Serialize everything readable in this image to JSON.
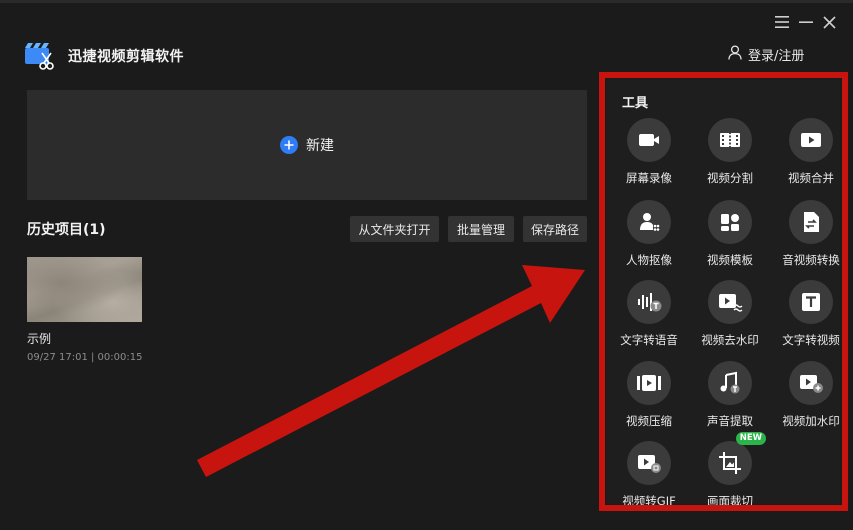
{
  "window": {
    "controls": [
      {
        "name": "menu",
        "icon": "hamburger-icon"
      },
      {
        "name": "minimize",
        "icon": "minimize-icon"
      },
      {
        "name": "close",
        "icon": "close-icon"
      }
    ]
  },
  "header": {
    "app_title": "迅捷视频剪辑软件",
    "logo_icon": "clapperboard-scissors-icon",
    "login_label": "登录/注册",
    "login_icon": "user-icon"
  },
  "new_project": {
    "label": "新建",
    "icon": "plus-circle-icon",
    "accent": "#2f7cf6"
  },
  "history": {
    "title": "历史项目(1)",
    "buttons": [
      "从文件夹打开",
      "批量管理",
      "保存路径"
    ],
    "items": [
      {
        "name": "示例",
        "meta": "09/27 17:01 | 00:00:15"
      }
    ]
  },
  "tools": {
    "title": "工具",
    "items": [
      {
        "label": "屏幕录像",
        "icon": "camera-icon"
      },
      {
        "label": "视频分割",
        "icon": "film-split-icon"
      },
      {
        "label": "视频合并",
        "icon": "video-merge-icon"
      },
      {
        "label": "人物抠像",
        "icon": "person-cutout-icon"
      },
      {
        "label": "视频模板",
        "icon": "template-icon"
      },
      {
        "label": "音视频转换",
        "icon": "file-convert-icon"
      },
      {
        "label": "文字转语音",
        "icon": "text-to-speech-icon"
      },
      {
        "label": "视频去水印",
        "icon": "remove-watermark-icon"
      },
      {
        "label": "文字转视频",
        "icon": "text-to-video-icon"
      },
      {
        "label": "视频压缩",
        "icon": "video-compress-icon"
      },
      {
        "label": "声音提取",
        "icon": "music-extract-icon"
      },
      {
        "label": "视频加水印",
        "icon": "add-watermark-icon"
      },
      {
        "label": "视频转GIF",
        "icon": "video-to-gif-icon"
      },
      {
        "label": "画面裁切",
        "icon": "crop-icon",
        "badge": "NEW"
      }
    ]
  },
  "annotation": {
    "color": "#c8140f"
  }
}
